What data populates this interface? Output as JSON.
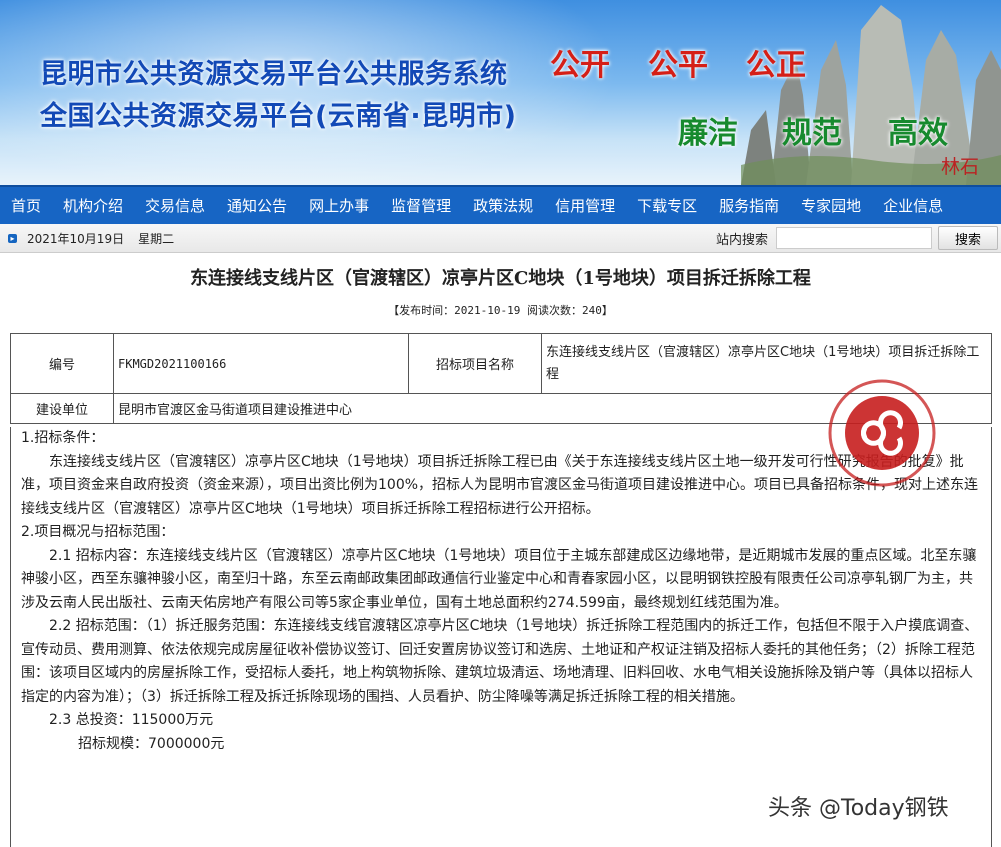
{
  "banner": {
    "title_line1": "昆明市公共资源交易平台公共服务系统",
    "title_line2": "全国公共资源交易平台(云南省·昆明市)",
    "slogan_red": [
      "公开",
      "公平",
      "公正"
    ],
    "slogan_green": [
      "廉洁",
      "规范",
      "高效"
    ],
    "stamp": "林石"
  },
  "nav": {
    "items": [
      "首页",
      "机构介绍",
      "交易信息",
      "通知公告",
      "网上办事",
      "监督管理",
      "政策法规",
      "信用管理",
      "下载专区",
      "服务指南",
      "专家园地",
      "企业信息"
    ]
  },
  "infobar": {
    "date": "2021年10月19日",
    "weekday": "星期二",
    "search_label": "站内搜索",
    "search_button": "搜索"
  },
  "article": {
    "title": "东连接线支线片区（官渡辖区）凉亭片区C地块（1号地块）项目拆迁拆除工程",
    "meta": "【发布时间：2021-10-19 阅读次数：240】"
  },
  "table": {
    "label_number": "编号",
    "number": "FKMGD2021100166",
    "label_project": "招标项目名称",
    "project": "东连接线支线片区（官渡辖区）凉亭片区C地块（1号地块）项目拆迁拆除工程",
    "label_unit": "建设单位",
    "unit": "昆明市官渡区金马街道项目建设推进中心"
  },
  "content": {
    "s1_heading": "1.招标条件：",
    "s1_text": "东连接线支线片区（官渡辖区）凉亭片区C地块（1号地块）项目拆迁拆除工程已由《关于东连接线支线片区土地一级开发可行性研究报告的批复》批准，项目资金来自政府投资（资金来源），项目出资比例为100%，招标人为昆明市官渡区金马街道项目建设推进中心。项目已具备招标条件，现对上述东连接线支线片区（官渡辖区）凉亭片区C地块（1号地块）项目拆迁拆除工程招标进行公开招标。",
    "s2_heading": "2.项目概况与招标范围：",
    "s21": "2.1 招标内容：东连接线支线片区（官渡辖区）凉亭片区C地块（1号地块）项目位于主城东部建成区边缘地带，是近期城市发展的重点区域。北至东骧神骏小区，西至东骧神骏小区，南至归十路，东至云南邮政集团邮政通信行业鉴定中心和青春家园小区，以昆明钢铁控股有限责任公司凉亭轧钢厂为主，共涉及云南人民出版社、云南天佑房地产有限公司等5家企事业单位，国有土地总面积约274.599亩，最终规划红线范围为准。",
    "s22": "2.2 招标范围：（1）拆迁服务范围：东连接线支线官渡辖区凉亭片区C地块（1号地块）拆迁拆除工程范围内的拆迁工作，包括但不限于入户摸底调查、宣传动员、费用测算、依法依规完成房屋征收补偿协议签订、回迁安置房协议签订和选房、土地证和产权证注销及招标人委托的其他任务；（2）拆除工程范围：该项目区域内的房屋拆除工作，受招标人委托，地上构筑物拆除、建筑垃圾清运、场地清理、旧料回收、水电气相关设施拆除及销户等（具体以招标人指定的内容为准）；（3）拆迁拆除工程及拆迁拆除现场的围挡、人员看护、防尘降噪等满足拆迁拆除工程的相关措施。",
    "s23": "2.3 总投资：115000万元",
    "s23b": "招标规模：7000000元"
  },
  "watermark": "头条 @Today钢铁",
  "colors": {
    "nav_bg": "#1765c4",
    "title_blue": "#1249b6",
    "slogan_red": "#d51f17",
    "slogan_green": "#178a2e",
    "seal_red": "#c61e1e"
  }
}
